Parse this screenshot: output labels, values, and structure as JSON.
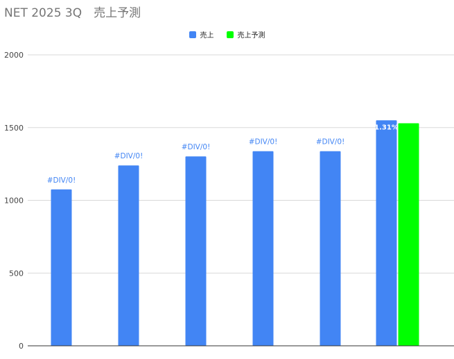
{
  "chart_data": {
    "type": "bar",
    "title": "NET 2025 3Q　売上予測",
    "categories": [
      "",
      "",
      "",
      "",
      "",
      ""
    ],
    "series": [
      {
        "name": "売上",
        "color": "#4285f4",
        "values": [
          1075,
          1240,
          1302,
          1338,
          1338,
          1550
        ],
        "data_labels": [
          "#DIV/0!",
          "#DIV/0!",
          "#DIV/0!",
          "#DIV/0!",
          "#DIV/0!",
          "1.31%"
        ]
      },
      {
        "name": "売上予測",
        "color": "#00ff00",
        "values": [
          null,
          null,
          null,
          null,
          null,
          1530
        ]
      }
    ],
    "ylim": [
      0,
      2000
    ],
    "yticks": [
      0,
      500,
      1000,
      1500,
      2000
    ],
    "grid": true,
    "legend_position": "top"
  }
}
